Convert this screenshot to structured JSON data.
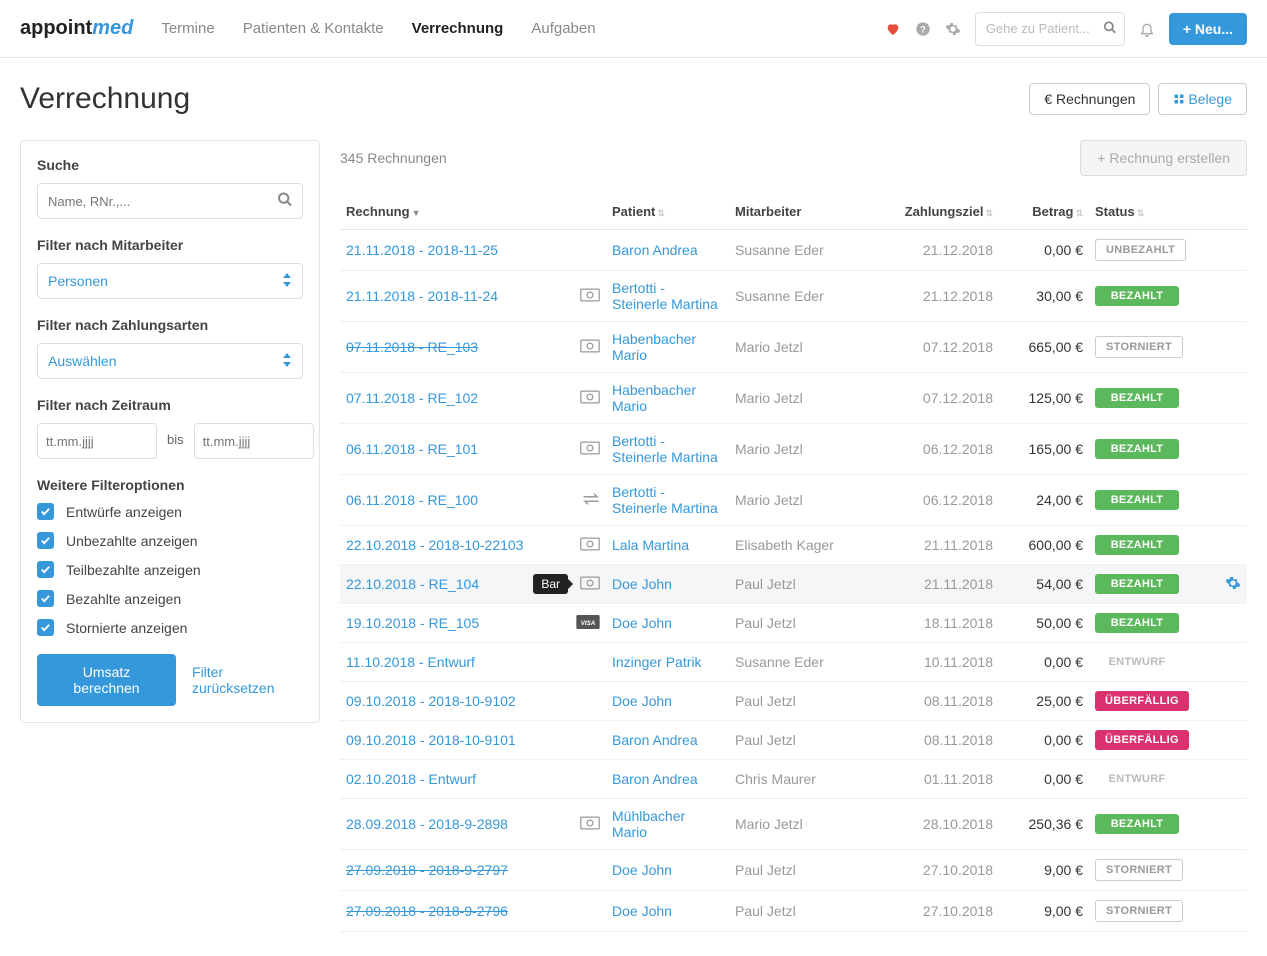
{
  "topbar": {
    "logo_a": "appoint",
    "logo_b": "med",
    "nav": [
      "Termine",
      "Patienten & Kontakte",
      "Verrechnung",
      "Aufgaben"
    ],
    "active_nav": 2,
    "search_placeholder": "Gehe zu Patient...",
    "new_btn": "+ Neu..."
  },
  "page": {
    "title": "Verrechnung",
    "tab_invoices": "€ Rechnungen",
    "tab_receipts": "Belege"
  },
  "filters": {
    "search_label": "Suche",
    "search_placeholder": "Name, RNr.,...",
    "staff_label": "Filter nach Mitarbeiter",
    "staff_select": "Personen",
    "paytype_label": "Filter nach Zahlungsarten",
    "paytype_select": "Auswählen",
    "period_label": "Filter nach Zeitraum",
    "date_placeholder": "tt.mm.jjjj",
    "bis": "bis",
    "more_label": "Weitere Filteroptionen",
    "opts": [
      "Entwürfe anzeigen",
      "Unbezahlte anzeigen",
      "Teilbezahlte anzeigen",
      "Bezahlte anzeigen",
      "Stornierte anzeigen"
    ],
    "calc_btn": "Umsatz berechnen",
    "reset_link": "Filter zurücksetzen"
  },
  "table": {
    "count": "345 Rechnungen",
    "create_btn": "+ Rechnung erstellen",
    "headers": {
      "rechnung": "Rechnung",
      "patient": "Patient",
      "mitarbeiter": "Mitarbeiter",
      "ziel": "Zahlungsziel",
      "betrag": "Betrag",
      "status": "Status"
    },
    "tooltip": "Bar",
    "status_labels": {
      "UNBEZAHLT": "UNBEZAHLT",
      "BEZAHLT": "BEZAHLT",
      "STORNIERT": "STORNIERT",
      "ENTWURF": "ENTWURF",
      "UEBERFAELLIG": "ÜBERFÄLLIG"
    },
    "rows": [
      {
        "re": "21.11.2018 - 2018-11-25",
        "pay": "",
        "pat": "Baron Andrea",
        "mit": "Susanne Eder",
        "ziel": "21.12.2018",
        "betrag": "0,00 €",
        "status": "UNBEZAHLT",
        "strike": false,
        "hover": false
      },
      {
        "re": "21.11.2018 - 2018-11-24",
        "pay": "cash",
        "pat": "Bertotti - Steinerle Martina",
        "mit": "Susanne Eder",
        "ziel": "21.12.2018",
        "betrag": "30,00 €",
        "status": "BEZAHLT",
        "strike": false,
        "hover": false
      },
      {
        "re": "07.11.2018 - RE_103",
        "pay": "cash",
        "pat": "Habenbacher Mario",
        "mit": "Mario Jetzl",
        "ziel": "07.12.2018",
        "betrag": "665,00 €",
        "status": "STORNIERT",
        "strike": true,
        "hover": false
      },
      {
        "re": "07.11.2018 - RE_102",
        "pay": "cash",
        "pat": "Habenbacher Mario",
        "mit": "Mario Jetzl",
        "ziel": "07.12.2018",
        "betrag": "125,00 €",
        "status": "BEZAHLT",
        "strike": false,
        "hover": false
      },
      {
        "re": "06.11.2018 - RE_101",
        "pay": "cash",
        "pat": "Bertotti - Steinerle Martina",
        "mit": "Mario Jetzl",
        "ziel": "06.12.2018",
        "betrag": "165,00 €",
        "status": "BEZAHLT",
        "strike": false,
        "hover": false
      },
      {
        "re": "06.11.2018 - RE_100",
        "pay": "transfer",
        "pat": "Bertotti - Steinerle Martina",
        "mit": "Mario Jetzl",
        "ziel": "06.12.2018",
        "betrag": "24,00 €",
        "status": "BEZAHLT",
        "strike": false,
        "hover": false
      },
      {
        "re": "22.10.2018 - 2018-10-22103",
        "pay": "cash",
        "pat": "Lala Martina",
        "mit": "Elisabeth Kager",
        "ziel": "21.11.2018",
        "betrag": "600,00 €",
        "status": "BEZAHLT",
        "strike": false,
        "hover": false
      },
      {
        "re": "22.10.2018 - RE_104",
        "pay": "cash",
        "pat": "Doe John",
        "mit": "Paul Jetzl",
        "ziel": "21.11.2018",
        "betrag": "54,00 €",
        "status": "BEZAHLT",
        "strike": false,
        "hover": true,
        "tooltip": true
      },
      {
        "re": "19.10.2018 - RE_105",
        "pay": "visa",
        "pat": "Doe John",
        "mit": "Paul Jetzl",
        "ziel": "18.11.2018",
        "betrag": "50,00 €",
        "status": "BEZAHLT",
        "strike": false,
        "hover": false
      },
      {
        "re": "11.10.2018 - Entwurf",
        "pay": "",
        "pat": "Inzinger Patrik",
        "mit": "Susanne Eder",
        "ziel": "10.11.2018",
        "betrag": "0,00 €",
        "status": "ENTWURF",
        "strike": false,
        "hover": false
      },
      {
        "re": "09.10.2018 - 2018-10-9102",
        "pay": "",
        "pat": "Doe John",
        "mit": "Paul Jetzl",
        "ziel": "08.11.2018",
        "betrag": "25,00 €",
        "status": "UEBERFAELLIG",
        "strike": false,
        "hover": false
      },
      {
        "re": "09.10.2018 - 2018-10-9101",
        "pay": "",
        "pat": "Baron Andrea",
        "mit": "Paul Jetzl",
        "ziel": "08.11.2018",
        "betrag": "0,00 €",
        "status": "UEBERFAELLIG",
        "strike": false,
        "hover": false
      },
      {
        "re": "02.10.2018 - Entwurf",
        "pay": "",
        "pat": "Baron Andrea",
        "mit": "Chris Maurer",
        "ziel": "01.11.2018",
        "betrag": "0,00 €",
        "status": "ENTWURF",
        "strike": false,
        "hover": false
      },
      {
        "re": "28.09.2018 - 2018-9-2898",
        "pay": "cash",
        "pat": "Mühlbacher Mario",
        "mit": "Mario Jetzl",
        "ziel": "28.10.2018",
        "betrag": "250,36 €",
        "status": "BEZAHLT",
        "strike": false,
        "hover": false
      },
      {
        "re": "27.09.2018 - 2018-9-2797",
        "pay": "",
        "pat": "Doe John",
        "mit": "Paul Jetzl",
        "ziel": "27.10.2018",
        "betrag": "9,00 €",
        "status": "STORNIERT",
        "strike": true,
        "hover": false
      },
      {
        "re": "27.09.2018 - 2018-9-2796",
        "pay": "",
        "pat": "Doe John",
        "mit": "Paul Jetzl",
        "ziel": "27.10.2018",
        "betrag": "9,00 €",
        "status": "STORNIERT",
        "strike": true,
        "hover": false
      }
    ]
  }
}
